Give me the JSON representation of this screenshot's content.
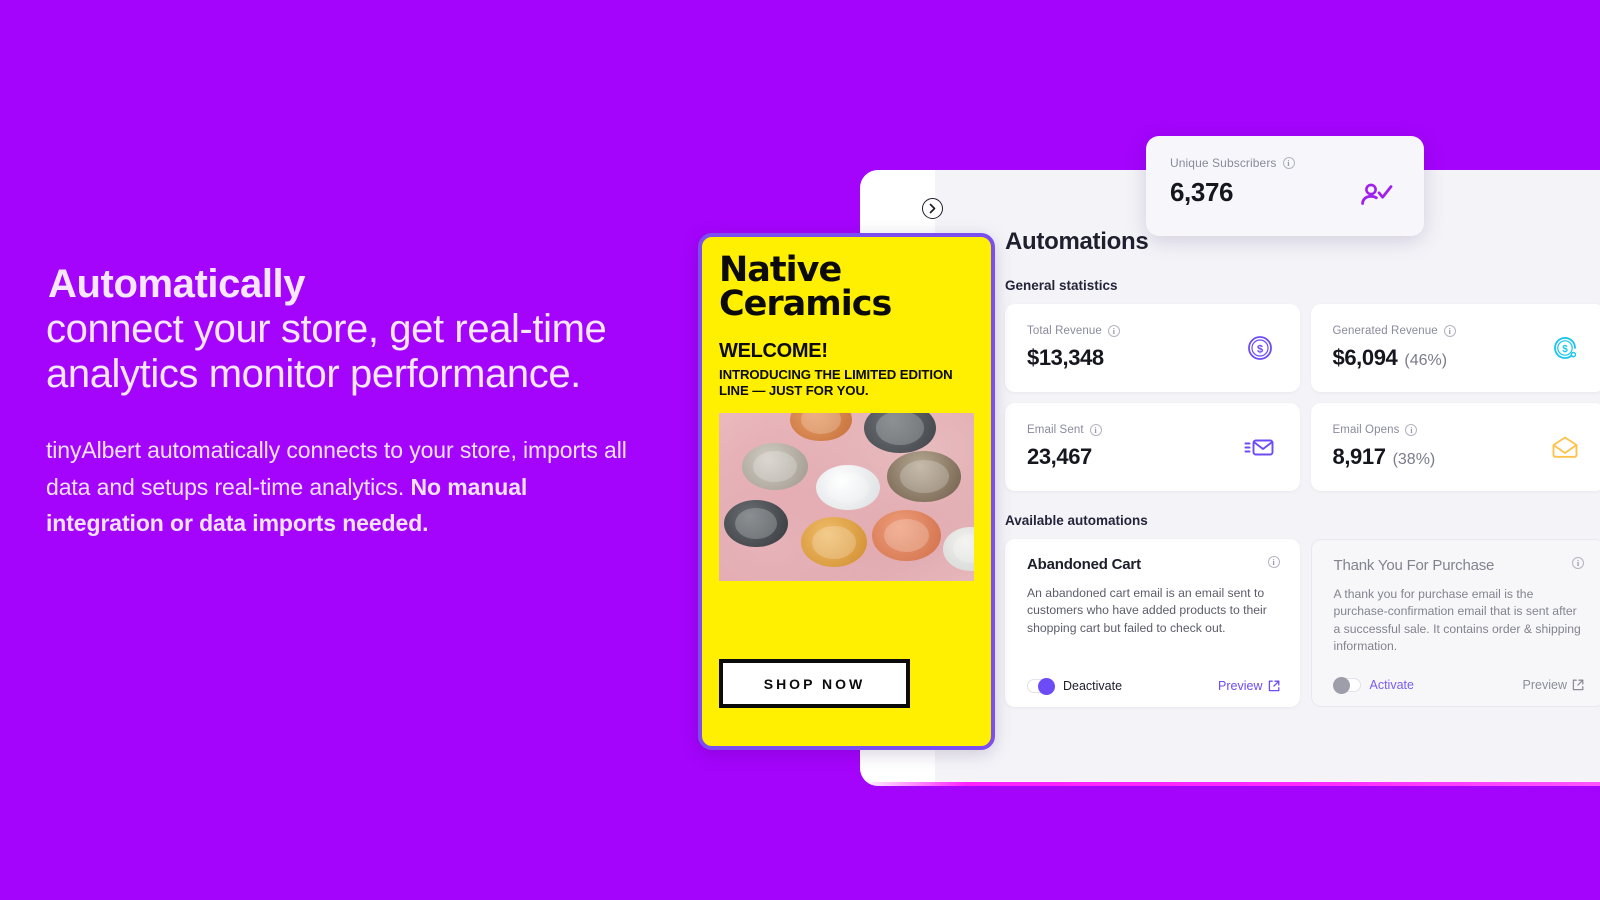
{
  "theme": {
    "background": "#a404fc",
    "accent_purple": "#6d4bf6",
    "email_yellow": "#ffef00",
    "glow_magenta": "#ff2bff",
    "cyan": "#18c6f0",
    "amber": "#ffc24d"
  },
  "marketing": {
    "headline_strong": "Automatically",
    "headline_rest": "connect your store, get real-time analytics monitor performance.",
    "body_plain": "tinyAlbert automatically connects to your store, imports all data and setups real-time analytics. ",
    "body_bold": "No manual integration or data imports needed."
  },
  "dashboard": {
    "collapse_icon": "chevron-right-circle-icon",
    "title": "Automations",
    "general_statistics_label": "General statistics",
    "available_automations_label": "Available automations",
    "info_glyph": "i",
    "floating_stat": {
      "label": "Unique Subscribers",
      "value": "6,376",
      "icon": "user-check-icon"
    },
    "stats": [
      {
        "label": "Total Revenue",
        "value": "$13,348",
        "percent": "",
        "icon": "dollar-circle-icon"
      },
      {
        "label": "Generated Revenue",
        "value": "$6,094",
        "percent": "(46%)",
        "icon": "dollar-refresh-icon"
      },
      {
        "label": "Email Sent",
        "value": "23,467",
        "percent": "",
        "icon": "mail-send-icon"
      },
      {
        "label": "Email Opens",
        "value": "8,917",
        "percent": "(38%)",
        "icon": "mail-open-icon"
      }
    ],
    "automations": [
      {
        "title": "Abandoned Cart",
        "description": "An abandoned cart email is an email sent to customers who have added products to their shopping cart but failed to check out.",
        "toggle_label": "Deactivate",
        "toggle_state": "on",
        "preview_label": "Preview",
        "info_icon": "info-circle-icon",
        "preview_icon": "external-link-icon"
      },
      {
        "title": "Thank You For Purchase",
        "description": "A thank you for purchase email is the purchase-confirmation email that is sent after a successful sale. It contains order & shipping information.",
        "toggle_label": "Activate",
        "toggle_state": "off",
        "preview_label": "Preview",
        "info_icon": "info-circle-icon",
        "preview_icon": "external-link-icon"
      }
    ]
  },
  "email_preview": {
    "brand_line1": "Native",
    "brand_line2": "Ceramics",
    "welcome": "WELCOME!",
    "subheading": "INTRODUCING THE LIMITED EDITION LINE — JUST FOR YOU.",
    "cta_label": "SHOP NOW",
    "photo_alt": "ceramic-bowls-photo"
  }
}
